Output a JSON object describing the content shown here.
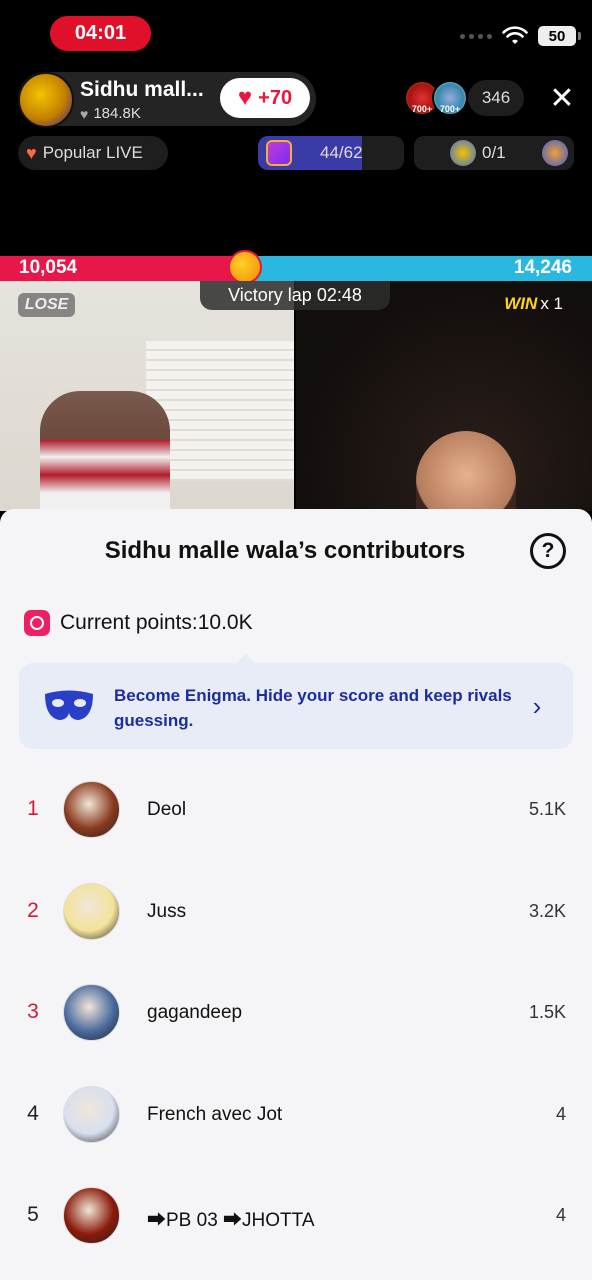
{
  "status_bar": {
    "time": "04:01",
    "battery": "50"
  },
  "host": {
    "name": "Sidhu mall...",
    "likes": "184.8K",
    "follow_bonus": "+70"
  },
  "viewers": {
    "count": "346",
    "badge1": "700+",
    "badge2": "700+"
  },
  "pills": {
    "popular": "Popular LIVE",
    "progress_text": "44/62",
    "progress_value": 0.71,
    "goal_text": "0/1"
  },
  "battle": {
    "left_score": "10,054",
    "right_score": "14,246",
    "lose_label": "LOSE",
    "victory_label": "Victory lap 02:48",
    "win_label": "WIN",
    "win_multiplier": "x 1"
  },
  "sheet": {
    "title": "Sidhu malle wala’s contributors",
    "help": "?",
    "points": "Current points:10.0K",
    "enigma_text": "Become Enigma. Hide your score and keep rivals guessing.",
    "contributors": [
      {
        "rank": "1",
        "name": "Deol",
        "score": "5.1K",
        "color": "#8a3a1e"
      },
      {
        "rank": "2",
        "name": "Juss",
        "score": "3.2K",
        "color": "#f3e39a"
      },
      {
        "rank": "3",
        "name": "gagandeep",
        "score": "1.5K",
        "color": "#4a6a9e"
      },
      {
        "rank": "4",
        "name": "French avec Jot",
        "score": "4",
        "color": "#d8dff0"
      },
      {
        "rank": "5",
        "name": "⮕PB 03 ⮕JHOTTA",
        "score": "4",
        "color": "#8a1a0a"
      }
    ]
  },
  "colors": {
    "accent": "#e8173b",
    "battle_left": "#e8174a",
    "battle_right": "#2ab8e0",
    "enigma": "#1e2d9e"
  }
}
